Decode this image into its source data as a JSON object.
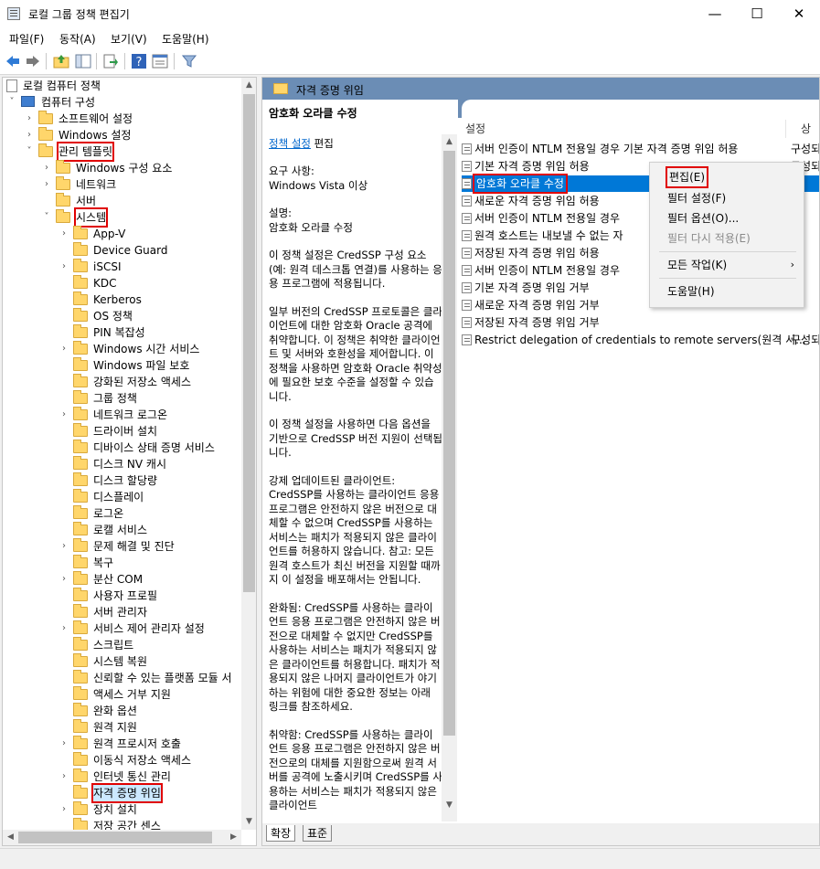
{
  "window": {
    "title": "로컬 그룹 정책 편집기",
    "minimize": "—",
    "maximize": "☐",
    "close": "✕"
  },
  "menu": [
    "파일(F)",
    "동작(A)",
    "보기(V)",
    "도움말(H)"
  ],
  "toolbar": {
    "back_icon": "back-arrow-icon",
    "forward_icon": "forward-arrow-icon",
    "up_icon": "up-folder-icon",
    "show_hide_tree_icon": "show-hide-tree-icon",
    "export_icon": "export-list-icon",
    "help_icon": "help-icon",
    "properties_icon": "properties-icon",
    "filter_icon": "filter-icon"
  },
  "tree": {
    "root": "로컬 컴퓨터 정책",
    "computer_config": "컴퓨터 구성",
    "software_settings": "소프트웨어 설정",
    "windows_settings": "Windows 설정",
    "admin_templates": "관리 템플릿",
    "windows_components": "Windows 구성 요소",
    "network": "네트워크",
    "server": "서버",
    "system": "시스템",
    "system_children": [
      "App-V",
      "Device Guard",
      "iSCSI",
      "KDC",
      "Kerberos",
      "OS 정책",
      "PIN 복잡성",
      "Windows 시간 서비스",
      "Windows 파일 보호",
      "강화된 저장소 액세스",
      "그룹 정책",
      "네트워크 로그온",
      "드라이버 설치",
      "디바이스 상태 증명 서비스",
      "디스크 NV 캐시",
      "디스크 할당량",
      "디스플레이",
      "로그온",
      "로캘 서비스",
      "문제 해결 및 진단",
      "복구",
      "분산 COM",
      "사용자 프로필",
      "서버 관리자",
      "서비스 제어 관리자 설정",
      "스크립트",
      "시스템 복원",
      "신뢰할 수 있는 플랫폼 모듈 서",
      "액세스 거부 지원",
      "완화 옵션",
      "원격 지원",
      "원격 프로시저 호출",
      "이동식 저장소 액세스",
      "인터넷 통신 관리",
      "자격 증명 위임",
      "장치 설치",
      "저장 공간 센스"
    ]
  },
  "right": {
    "header_title": "자격 증명 위임",
    "description": {
      "title": "암호화 오라클 수정",
      "policy_link": "정책 설정",
      "edit_word": " 편집",
      "req_label": "요구 사항:",
      "req_value": "Windows Vista 이상",
      "desc_label": "설명:",
      "desc_value": "암호화 오라클 수정",
      "para1": "이 정책 설정은 CredSSP 구성 요소(예: 원격 데스크톱 연결)를 사용하는 응용 프로그램에 적용됩니다.",
      "para2": "일부 버전의 CredSSP 프로토콜은 클라이언트에 대한 암호화 Oracle 공격에 취약합니다. 이 정책은 취약한 클라이언트 및 서버와 호환성을 제어합니다. 이 정책을 사용하면 암호화 Oracle 취약성에 필요한 보호 수준을 설정할 수 있습니다.",
      "para3": "이 정책 설정을 사용하면 다음 옵션을 기반으로 CredSSP 버전 지원이 선택됩니다.",
      "para4": "강제 업데이트된 클라이언트: CredSSP를 사용하는 클라이언트 응용 프로그램은 안전하지 않은 버전으로 대체할 수 없으며 CredSSP를 사용하는 서비스는 패치가 적용되지 않은 클라이언트를 허용하지 않습니다. 참고: 모든 원격 호스트가 최신 버전을 지원할 때까지 이 설정을 배포해서는 안됩니다.",
      "para5": "완화됨: CredSSP를 사용하는 클라이언트 응용 프로그램은 안전하지 않은 버전으로 대체할 수 없지만 CredSSP를 사용하는 서비스는 패치가 적용되지 않은 클라이언트를 허용합니다. 패치가 적용되지 않은 나머지 클라이언트가 야기하는 위험에 대한 중요한 정보는 아래 링크를 참조하세요.",
      "para6": "취약함: CredSSP를 사용하는 클라이언트 응용 프로그램은 안전하지 않은 버전으로의 대체를 지원함으로써 원격 서버를 공격에 노출시키며 CredSSP를 사용하는 서비스는 패치가 적용되지 않은 클라이언트"
    },
    "columns": {
      "setting": "설정",
      "state": "상"
    },
    "rows": [
      {
        "name": "서버 인증이 NTLM 전용일 경우 기본 자격 증명 위임 허용",
        "state": "구성되"
      },
      {
        "name": "기본 자격 증명 위임 허용",
        "state": "구성되"
      },
      {
        "name": "암호화 오라클 수정",
        "state": "사"
      },
      {
        "name": "새로운 자격 증명 위임 허용",
        "state": ""
      },
      {
        "name": "서버 인증이 NTLM 전용일 경우",
        "state": ""
      },
      {
        "name": "원격 호스트는 내보낼 수 없는 자",
        "state": ""
      },
      {
        "name": "저장된 자격 증명 위임 허용",
        "state": ""
      },
      {
        "name": "서버 인증이 NTLM 전용일 경우",
        "state": ""
      },
      {
        "name": "기본 자격 증명 위임 거부",
        "state": ""
      },
      {
        "name": "새로운 자격 증명 위임 거부",
        "state": ""
      },
      {
        "name": "저장된 자격 증명 위임 거부",
        "state": ""
      },
      {
        "name": "Restrict delegation of credentials to remote servers(원격 서...",
        "state": "구성되"
      }
    ],
    "tabs": [
      "확장",
      "표준"
    ]
  },
  "context_menu": {
    "edit": "편집(E)",
    "filter_settings": "필터 설정(F)",
    "filter_options": "필터 옵션(O)...",
    "reapply_filter": "필터 다시 적용(E)",
    "all_tasks": "모든 작업(K)",
    "all_tasks_arrow": "›",
    "help": "도움말(H)"
  },
  "colors": {
    "highlight_box": "#e00000",
    "selected_row": "#0078d7",
    "header_band": "#6b8db5"
  }
}
